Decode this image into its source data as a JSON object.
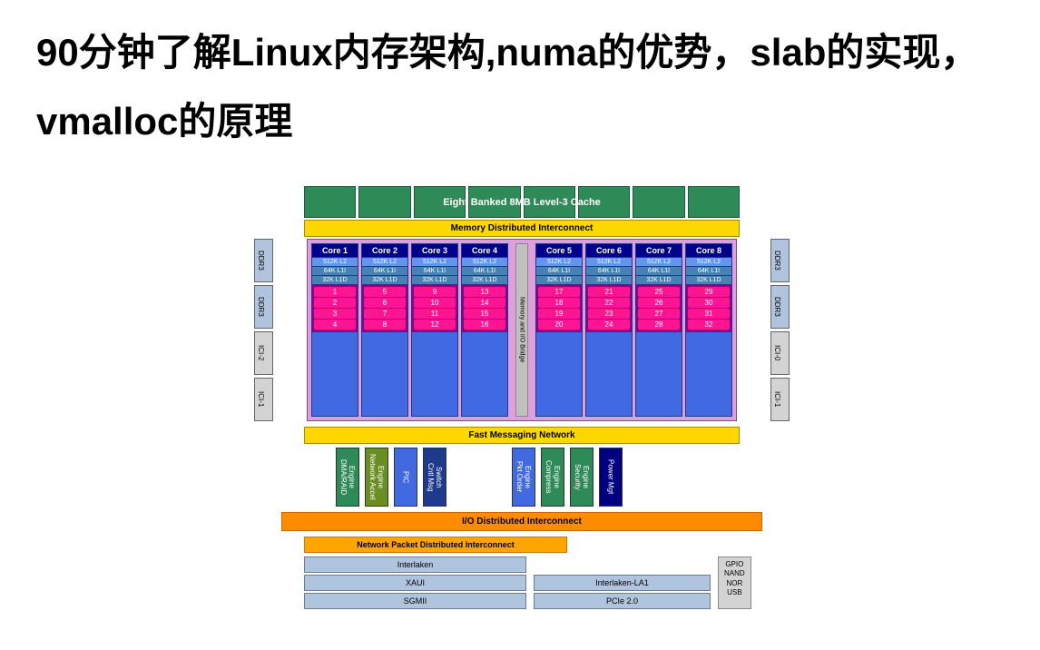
{
  "title": "90分钟了解Linux内存架构,numa的优势，slab的实现，vmalloc的原理",
  "l3cache_label": "Eight Banked 8MB Level-3 Cache",
  "mem_interconnect": "Memory Distributed Interconnect",
  "io_bridge": "Memory and I/O Bridge",
  "side_left": [
    "DDR3",
    "DDR3",
    "ICI-2",
    "ICI-1"
  ],
  "side_right": [
    "DDR3",
    "DDR3",
    "ICI-0",
    "ICI-1"
  ],
  "cores": [
    {
      "name": "Core 1",
      "l2": "512K L2",
      "l1i": "64K L1I",
      "l1d": "32K L1D",
      "threads": [
        "1",
        "2",
        "3",
        "4"
      ]
    },
    {
      "name": "Core 2",
      "l2": "512K L2",
      "l1i": "64K L1I",
      "l1d": "32K L1D",
      "threads": [
        "5",
        "6",
        "7",
        "8"
      ]
    },
    {
      "name": "Core 3",
      "l2": "512K L2",
      "l1i": "64K L1I",
      "l1d": "32K L1D",
      "threads": [
        "9",
        "10",
        "11",
        "12"
      ]
    },
    {
      "name": "Core 4",
      "l2": "512K L2",
      "l1i": "64K L1I",
      "l1d": "32K L1D",
      "threads": [
        "13",
        "14",
        "15",
        "16"
      ]
    },
    {
      "name": "Core 5",
      "l2": "512K L2",
      "l1i": "64K L1I",
      "l1d": "32K L1D",
      "threads": [
        "17",
        "18",
        "19",
        "20"
      ]
    },
    {
      "name": "Core 6",
      "l2": "512K L2",
      "l1i": "64K L1I",
      "l1d": "32K L1D",
      "threads": [
        "21",
        "22",
        "23",
        "24"
      ]
    },
    {
      "name": "Core 7",
      "l2": "512K L2",
      "l1i": "64K L1I",
      "l1d": "32K L1D",
      "threads": [
        "25",
        "26",
        "27",
        "28"
      ]
    },
    {
      "name": "Core 8",
      "l2": "512K L2",
      "l1i": "64K L1I",
      "l1d": "32K L1D",
      "threads": [
        "29",
        "30",
        "31",
        "32"
      ]
    }
  ],
  "fast_msg": "Fast Messaging Network",
  "engines": [
    {
      "label": "DMA/RAID Engine",
      "cls": "eng-green"
    },
    {
      "label": "Network Accel Engine",
      "cls": "eng-olive"
    },
    {
      "label": "PIC",
      "cls": "eng-blue"
    },
    {
      "label": "Cntl Msg Switch",
      "cls": "eng-dark"
    },
    {
      "label": "Pkt Order Engine",
      "cls": "eng-blue"
    },
    {
      "label": "Compress Engine",
      "cls": "eng-green"
    },
    {
      "label": "Security Engine",
      "cls": "eng-green"
    },
    {
      "label": "Power Mgt",
      "cls": "eng-navy"
    }
  ],
  "io_interconnect": "I/O Distributed Interconnect",
  "npdi": "Network Packet Distributed Interconnect",
  "ifaces_left": [
    "Interlaken",
    "XAUI",
    "SGMII"
  ],
  "ifaces_right": [
    "Interlaken-LA1",
    "PCIe 2.0"
  ],
  "gpio_lines": [
    "GPIO",
    "NAND",
    "NOR",
    "USB"
  ]
}
